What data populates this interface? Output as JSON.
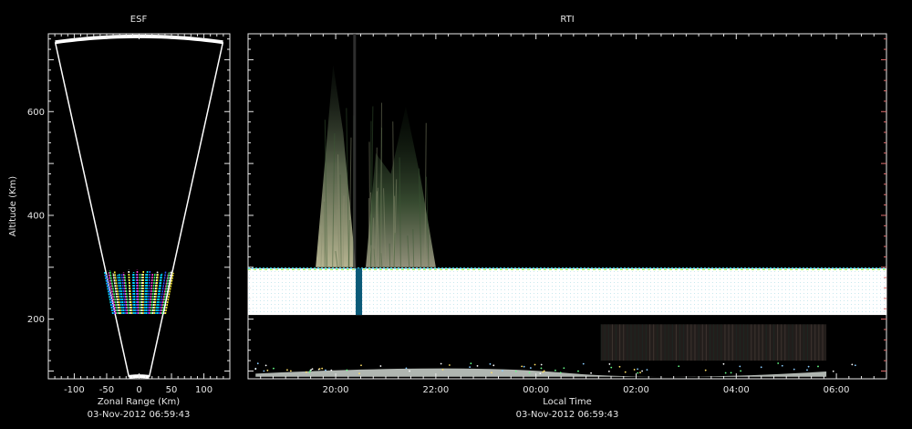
{
  "chart_data": [
    {
      "type": "scatter",
      "title": "ESF",
      "xlabel": "Zonal Range (Km)",
      "ylabel": "Altitude (Km)",
      "timestamp": "03-Nov-2012 06:59:43",
      "xlim": [
        -140,
        140
      ],
      "ylim": [
        85,
        750
      ],
      "xticks": [
        -100,
        -50,
        0,
        50,
        100
      ],
      "xtick_labels": [
        "-100",
        "-50",
        "0",
        "50",
        "100"
      ],
      "yticks": [
        200,
        400,
        600
      ],
      "ytick_labels": [
        "200",
        "400",
        "600"
      ],
      "fan": {
        "r_min": 90,
        "r_max": 745,
        "half_angle_deg": 10
      },
      "echo_region": {
        "alt_min": 210,
        "alt_max": 290,
        "zonal_min": -45,
        "zonal_max": 45
      },
      "echo_colors": [
        "#00e5ff",
        "#2a52ff",
        "#ff3fd4",
        "#33ff66",
        "#ffffff",
        "#ffee33",
        "#00b4ff"
      ],
      "grid": false
    },
    {
      "type": "heatmap",
      "title": "RTI",
      "xlabel": "Local Time",
      "timestamp": "03-Nov-2012 06:59:43",
      "xlim_hours": [
        18.25,
        31.0
      ],
      "ylim": [
        85,
        750
      ],
      "xticks_hours": [
        20,
        22,
        24,
        26,
        28,
        30
      ],
      "xtick_labels": [
        "20:00",
        "22:00",
        "00:00",
        "02:00",
        "04:00",
        "06:00"
      ],
      "yticks": [
        200,
        400,
        600
      ],
      "bands": [
        {
          "name": "saturated layer",
          "alt_min": 208,
          "alt_max": 298,
          "start_hour": 18.25,
          "end_hour": 31.0,
          "color": "#ffffff"
        },
        {
          "name": "low altitude echoes",
          "alt_min": 95,
          "alt_max": 110,
          "start_hour": 18.4,
          "end_hour": 29.8,
          "color": "#cfd6d0"
        }
      ],
      "plumes": [
        {
          "start_hour": 19.6,
          "end_hour": 20.4,
          "alt_min": 300,
          "alt_max": 690
        },
        {
          "start_hour": 20.6,
          "end_hour": 22.0,
          "alt_min": 300,
          "alt_max": 610
        }
      ],
      "accent_colors": {
        "axis": "#e8e8e8",
        "right_ticks": "#e07070"
      },
      "grid": false
    }
  ]
}
